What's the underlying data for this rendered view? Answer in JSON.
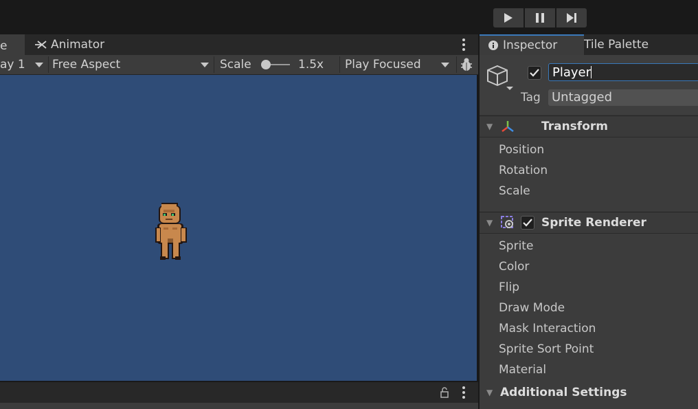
{
  "toolbar": {
    "play_icon": "play-icon",
    "pause_icon": "pause-icon",
    "step_icon": "step-icon"
  },
  "game_view": {
    "tabs": [
      {
        "label": "e"
      },
      {
        "label": "Animator",
        "icon": "animator-icon"
      }
    ],
    "display_label": "ay 1",
    "aspect_label": "Free Aspect",
    "scale_label": "Scale",
    "scale_value": "1.5x",
    "scale_slider_fraction": 0.0,
    "play_mode_label": "Play Focused",
    "viewport_color": "#2f4c77",
    "character": "player-sprite"
  },
  "inspector": {
    "tabs": [
      {
        "label": "Inspector",
        "icon": "info-icon"
      },
      {
        "label": "Tile Palette"
      }
    ],
    "gameobject": {
      "active": true,
      "name": "Player",
      "tag_label": "Tag",
      "tag_value": "Untagged"
    },
    "transform": {
      "title": "Transform",
      "properties": [
        "Position",
        "Rotation",
        "Scale"
      ]
    },
    "sprite_renderer": {
      "title": "Sprite Renderer",
      "enabled": true,
      "properties": [
        "Sprite",
        "Color",
        "Flip",
        "Draw Mode",
        "Mask Interaction",
        "Sprite Sort Point",
        "Material"
      ]
    },
    "additional_settings": {
      "title": "Additional Settings"
    }
  }
}
